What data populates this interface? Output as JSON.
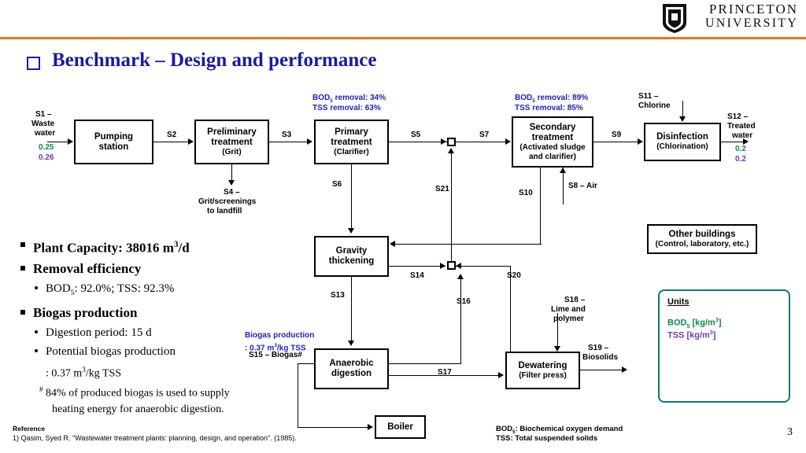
{
  "header": {
    "university_line1": "PRINCETON",
    "university_line2": "UNIVERSITY"
  },
  "slide": {
    "title": "Benchmark – Design and performance",
    "page_number": "3"
  },
  "diagram": {
    "boxes": [
      {
        "id": "pumping",
        "title": "Pumping",
        "title2": "station",
        "sub": ""
      },
      {
        "id": "preliminary",
        "title": "Preliminary",
        "title2": "treatment",
        "sub": "(Grit)"
      },
      {
        "id": "primary",
        "title": "Primary",
        "title2": "treatment",
        "sub": "(Clarifier)"
      },
      {
        "id": "secondary",
        "title": "Secondary",
        "title2": "treatment",
        "sub": "(Activated sludge",
        "sub2": "and clarifier)"
      },
      {
        "id": "disinfection",
        "title": "Disinfection",
        "title2": "",
        "sub": "(Chlorination)"
      },
      {
        "id": "gravity",
        "title": "Gravity",
        "title2": "thickening",
        "sub": ""
      },
      {
        "id": "anaerobic",
        "title": "Anaerobic",
        "title2": "digestion",
        "sub": ""
      },
      {
        "id": "dewatering",
        "title": "Dewatering",
        "title2": "",
        "sub": "(Filter press)"
      },
      {
        "id": "boiler",
        "title": "Boiler",
        "title2": "",
        "sub": ""
      },
      {
        "id": "other",
        "title": "Other buildings",
        "title2": "",
        "sub": "(Control, laboratory, etc.)"
      }
    ],
    "streams": {
      "s1": "S1 –",
      "s1b": "Waste",
      "s1c": "water",
      "s1_val1": "0.25",
      "s1_val2": "0.26",
      "s2": "S2",
      "s3": "S3",
      "s4": "S4 –",
      "s4b": "Grit/screenings",
      "s4c": "to landfill",
      "s5": "S5",
      "s6": "S6",
      "s7": "S7",
      "s8": "S8 – Air",
      "s9": "S9",
      "s10": "S10",
      "s11": "S11 –",
      "s11b": "Chlorine",
      "s12": "S12 –",
      "s12b": "Treated",
      "s12c": "water",
      "s12_val1": "0.2",
      "s12_val2": "0.2",
      "s13": "S13",
      "s14": "S14",
      "s15": "S15 – Biogas#",
      "s16": "S16",
      "s17": "S17",
      "s18": "S18 –",
      "s18b": "Lime and",
      "s18c": "polymer",
      "s19": "S19 –",
      "s19b": "Biosolids",
      "s20": "S20",
      "s21": "S21"
    },
    "annotations": {
      "primary_removal_bod": "BOD5 removal: 34%",
      "primary_removal_tss": "TSS removal: 63%",
      "secondary_removal_bod": "BOD5 removal: 89%",
      "secondary_removal_tss": "TSS removal: 85%",
      "biogas_line1": "Biogas production",
      "biogas_line2": ": 0.37 m3/kg TSS"
    }
  },
  "bullets": {
    "capacity": "Plant Capacity: 38016 m3/d",
    "removal_efficiency": "Removal efficiency",
    "removal_values": "BOD5: 92.0%; TSS: 92.3%",
    "biogas_production": "Biogas production",
    "digestion_period": "Digestion period: 15 d",
    "potential_biogas": "Potential biogas production",
    "potential_biogas_value": ": 0.37 m3/kg TSS",
    "footnote_a": "# 84% of produced biogas is used to supply",
    "footnote_b": "heating energy for anaerobic digestion."
  },
  "units_box": {
    "title": "Units",
    "bod": "BOD5 [kg/m3]",
    "tss": "TSS [kg/m3]",
    "accent": "#0b7a6e",
    "bod_color": "#0b8a4b",
    "tss_color": "#6a3ab2"
  },
  "footer": {
    "reference_label": "Reference",
    "reference_text": "1) Qasim, Syed R. \"Wastewater treatment plants: planning, design, and operation\". (1985).",
    "bod_def": "BOD5: Biochemical oxygen demand",
    "tss_def": "TSS: Total suspended solids"
  }
}
